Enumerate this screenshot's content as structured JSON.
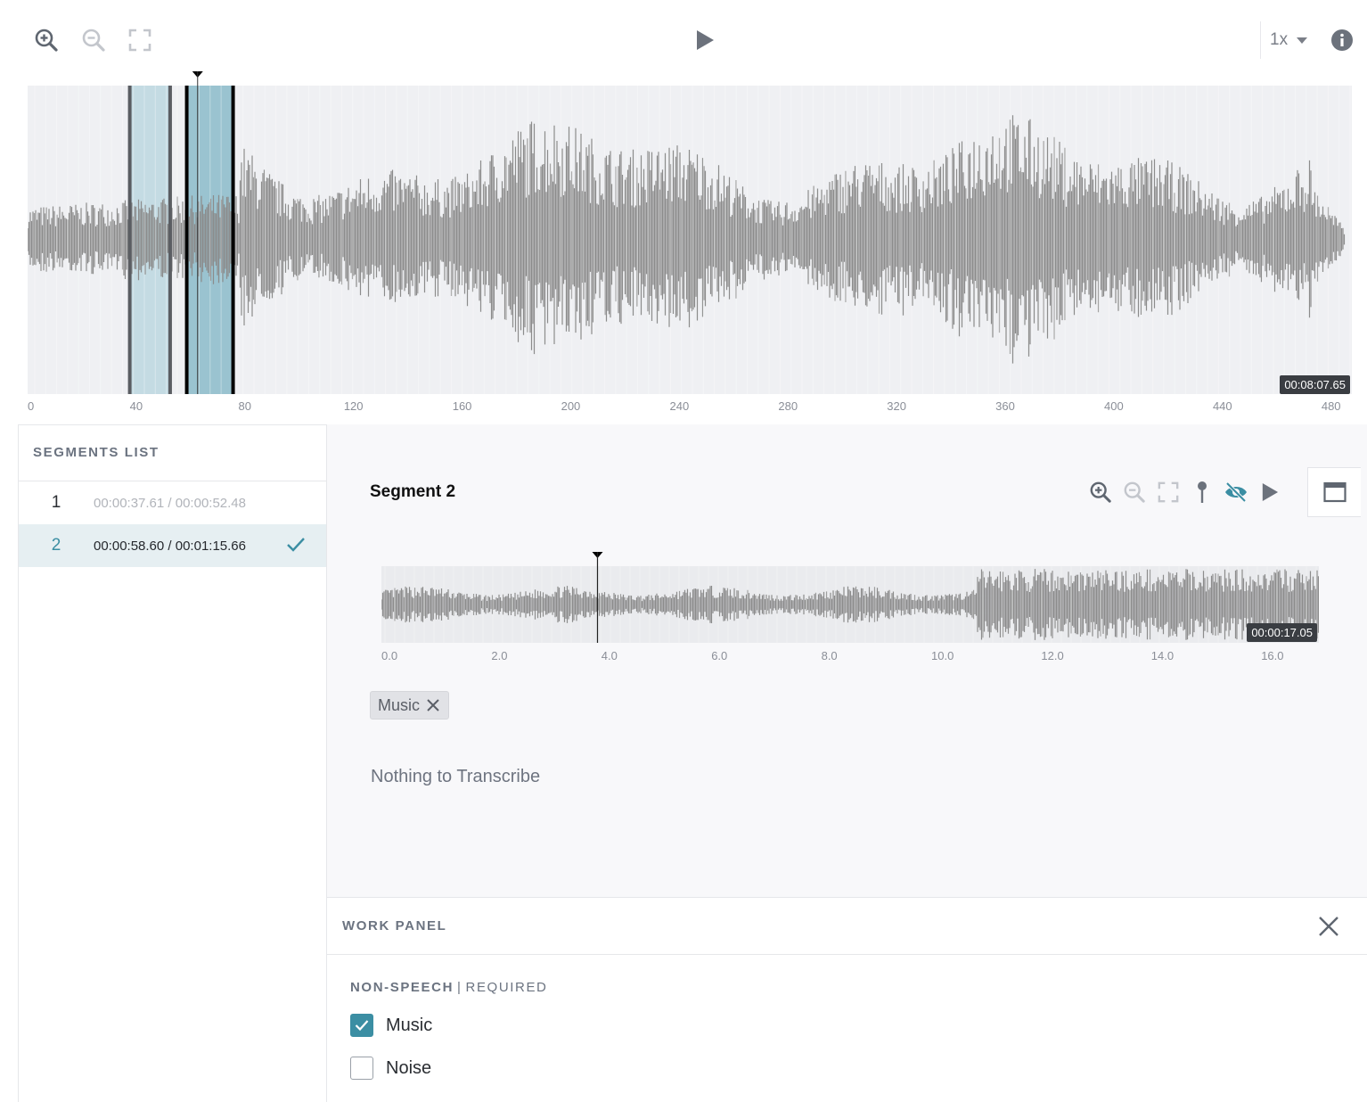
{
  "toolbar": {
    "zoom_in_icon": "zoom-in-icon",
    "zoom_out_icon": "zoom-out-icon",
    "fit_icon": "fit-screen-icon",
    "play_icon": "play-icon",
    "speed": "1x",
    "info_icon": "info-icon"
  },
  "main_waveform": {
    "duration_label": "00:08:07.65",
    "ticks": [
      "0",
      "40",
      "80",
      "120",
      "160",
      "200",
      "240",
      "280",
      "320",
      "360",
      "400",
      "440",
      "480"
    ],
    "axis_max_seconds": 487.65,
    "segments": [
      {
        "start_seconds": 37.61,
        "end_seconds": 52.48,
        "selected": false
      },
      {
        "start_seconds": 58.6,
        "end_seconds": 75.66,
        "selected": true
      }
    ],
    "playhead_seconds": 62.6
  },
  "segments_list": {
    "title": "SEGMENTS LIST",
    "items": [
      {
        "number": "1",
        "time": "00:00:37.61 / 00:00:52.48",
        "active": false,
        "done": false
      },
      {
        "number": "2",
        "time": "00:00:58.60 / 00:01:15.66",
        "active": true,
        "done": true
      }
    ]
  },
  "segment_detail": {
    "title": "Segment 2",
    "tools": [
      "zoom-in-icon",
      "zoom-out-icon",
      "fit-screen-icon",
      "pin-icon",
      "hide-icon",
      "play-icon"
    ],
    "window_icon": "window-icon",
    "duration_label": "00:00:17.05",
    "axis_max_seconds": 17.05,
    "ticks": [
      "0.0",
      "2.0",
      "4.0",
      "6.0",
      "8.0",
      "10.0",
      "12.0",
      "14.0",
      "16.0"
    ],
    "playhead_seconds": 3.93,
    "tags": [
      "Music"
    ],
    "transcription_placeholder": "Nothing to Transcribe"
  },
  "work_panel": {
    "title": "WORK PANEL",
    "group_label": "NON-SPEECH",
    "group_separator": "|",
    "group_required": "REQUIRED",
    "options": [
      {
        "label": "Music",
        "checked": true
      },
      {
        "label": "Noise",
        "checked": false
      }
    ]
  },
  "colors": {
    "accent": "#3b8ea3",
    "waveform": "#8c8c8c",
    "waveform_bg": "#eff0f3",
    "segment_fill": "#c4dbe3",
    "segment_selected_fill": "#9ac3d0"
  }
}
